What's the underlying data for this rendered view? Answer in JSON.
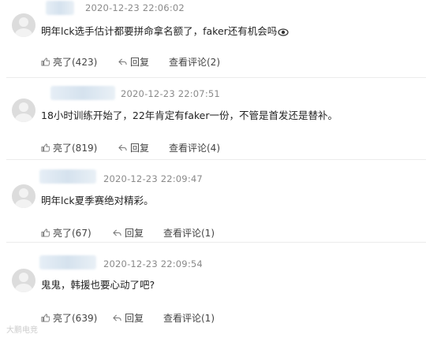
{
  "comments": [
    {
      "timestamp": "2020-12-23 22:06:02",
      "text": "明年lck选手估计都要拼命拿名额了，faker还有机会吗",
      "emoji": "eye-emoji",
      "like_label": "亮了(423)",
      "reply_label": "回复",
      "view_label": "查看评论(2)"
    },
    {
      "timestamp": "2020-12-23 22:07:51",
      "text": "18小时训练开始了，22年肯定有faker一份，不管是首发还是替补。",
      "like_label": "亮了(819)",
      "reply_label": "回复",
      "view_label": "查看评论(4)"
    },
    {
      "timestamp": "2020-12-23 22:09:47",
      "text": "明年lck夏季赛绝对精彩。",
      "like_label": "亮了(67)",
      "reply_label": "回复",
      "view_label": "查看评论(1)"
    },
    {
      "timestamp": "2020-12-23 22:09:54",
      "text": "鬼鬼，韩援也要心动了吧?",
      "like_label": "亮了(639)",
      "reply_label": "回复",
      "view_label": "查看评论(1)"
    }
  ],
  "watermark": "大鹏电竞"
}
